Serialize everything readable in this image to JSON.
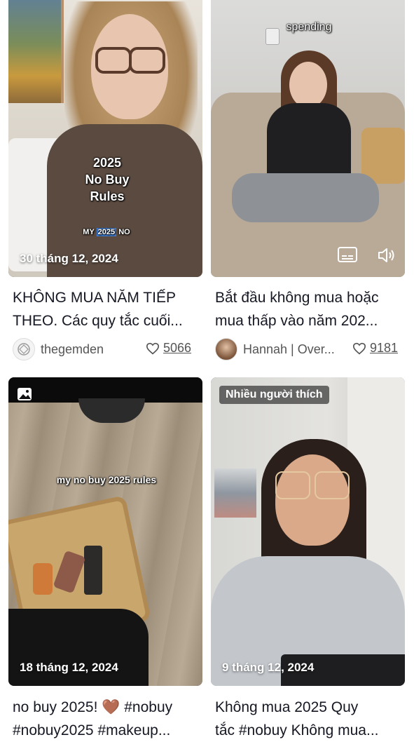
{
  "videos": [
    {
      "overlay_title": [
        "2025",
        "No Buy",
        "Rules"
      ],
      "overlay_sub_pre": "MY ",
      "overlay_sub_hl": "2025",
      "overlay_sub_post": " NO",
      "date": "30 tháng 12, 2024",
      "caption_line1": "KHÔNG MUA NĂM TIẾP",
      "caption_line2": "THEO. Các quy tắc cuối...",
      "author": "thegemden",
      "likes": "5066"
    },
    {
      "overlay_top": "spending",
      "caption_line1": "Bắt đầu không mua hoặc",
      "caption_line2": "mua thấp vào năm 202...",
      "author": "Hannah | Over...",
      "likes": "9181"
    },
    {
      "overlay_text": "my no buy 2025 rules",
      "date": "18 tháng 12, 2024",
      "caption_line1": "no buy 2025! 🤎 #nobuy",
      "caption_line2": "#nobuy2025 #makeup...",
      "media_icon": "photo-icon"
    },
    {
      "badge": "Nhiều người thích",
      "date": "9 tháng 12, 2024",
      "caption_line1": "Không mua 2025 Quy",
      "caption_line2": "tắc #nobuy Không mua..."
    }
  ]
}
